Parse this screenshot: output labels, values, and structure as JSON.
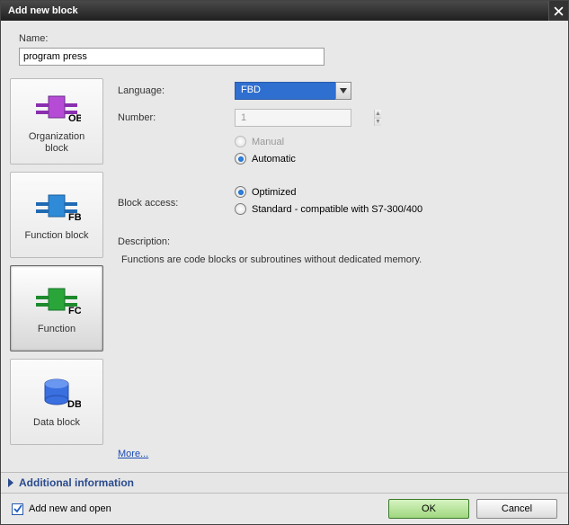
{
  "title": "Add new block",
  "name": {
    "label": "Name:",
    "value": "program press"
  },
  "tiles": [
    {
      "label": "Organization\nblock",
      "tag": "OB"
    },
    {
      "label": "Function block",
      "tag": "FB"
    },
    {
      "label": "Function",
      "tag": "FC"
    },
    {
      "label": "Data block",
      "tag": "DB"
    }
  ],
  "form": {
    "language_label": "Language:",
    "language_value": "FBD",
    "number_label": "Number:",
    "number_value": "1",
    "manual_label": "Manual",
    "automatic_label": "Automatic",
    "blockaccess_label": "Block access:",
    "optimized_label": "Optimized",
    "standard_label": "Standard - compatible with S7-300/400",
    "description_label": "Description:",
    "description_text": "Functions are code blocks or subroutines without dedicated memory.",
    "more_label": "More..."
  },
  "additional_info_label": "Additional  information",
  "footer": {
    "add_open_label": "Add new and open",
    "ok_label": "OK",
    "cancel_label": "Cancel"
  }
}
